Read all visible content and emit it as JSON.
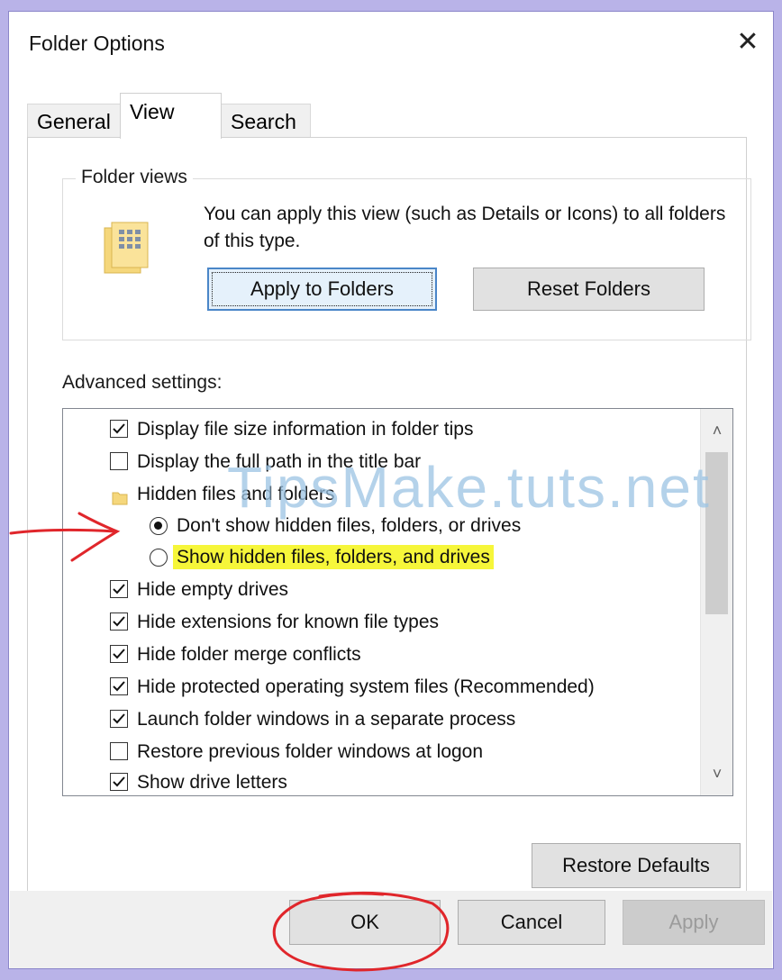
{
  "window": {
    "title": "Folder Options",
    "close_label": "✕"
  },
  "tabs": [
    {
      "label": "General",
      "active": false
    },
    {
      "label": "View",
      "active": true
    },
    {
      "label": "Search",
      "active": false
    }
  ],
  "folder_views": {
    "legend": "Folder views",
    "description": "You can apply this view (such as Details or Icons) to all folders of this type.",
    "apply_button": "Apply to Folders",
    "reset_button": "Reset Folders",
    "icon": "folder-views-icon"
  },
  "advanced": {
    "label": "Advanced settings:",
    "items": [
      {
        "type": "checkbox",
        "label": "Display file size information in folder tips",
        "checked": true
      },
      {
        "type": "checkbox",
        "label": "Display the full path in the title bar",
        "checked": false
      },
      {
        "type": "folder",
        "label": "Hidden files and folders"
      },
      {
        "type": "radio",
        "label": "Don't show hidden files, folders, or drives",
        "checked": true
      },
      {
        "type": "radio",
        "label": "Show hidden files, folders, and drives",
        "checked": false,
        "highlighted": true
      },
      {
        "type": "checkbox",
        "label": "Hide empty drives",
        "checked": true
      },
      {
        "type": "checkbox",
        "label": "Hide extensions for known file types",
        "checked": true
      },
      {
        "type": "checkbox",
        "label": "Hide folder merge conflicts",
        "checked": true
      },
      {
        "type": "checkbox",
        "label": "Hide protected operating system files (Recommended)",
        "checked": true
      },
      {
        "type": "checkbox",
        "label": "Launch folder windows in a separate process",
        "checked": true
      },
      {
        "type": "checkbox",
        "label": "Restore previous folder windows at logon",
        "checked": false
      },
      {
        "type": "checkbox",
        "label": "Show drive letters",
        "checked": true
      }
    ],
    "scroll_up": "˄",
    "scroll_down": "˅"
  },
  "restore_defaults": "Restore Defaults",
  "footer": {
    "ok": "OK",
    "cancel": "Cancel",
    "apply": "Apply"
  },
  "watermark": "TipsMake.tuts.net",
  "colors": {
    "highlight": "#f6f63a",
    "annotation": "#e0262b",
    "focus": "#4a86c8"
  }
}
